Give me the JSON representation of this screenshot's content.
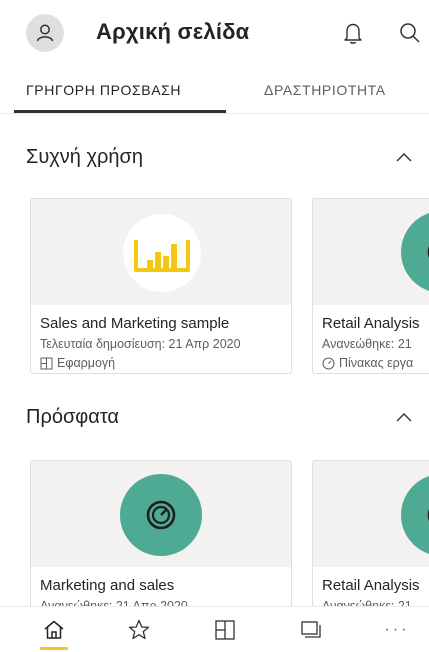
{
  "header": {
    "title": "Αρχική σελίδα",
    "avatar_icon": "person-icon",
    "notification_icon": "bell-icon",
    "search_icon": "search-icon"
  },
  "tabs": [
    {
      "label": "ΓΡΗΓΟΡΗ ΠΡΟΣΒΑΣΗ",
      "active": true
    },
    {
      "label": "ΔΡΑΣΤΗΡΙΟΤΗΤΑ",
      "active": false
    }
  ],
  "sections": {
    "frequent": {
      "title": "Συχνή χρήση",
      "cards": [
        {
          "title": "Sales and Marketing sample",
          "subtitle": "Τελευταία δημοσίευση: 21 Απρ 2020",
          "type_label": "Εφαρμογή",
          "type_icon": "app-icon",
          "thumb_icon": "bar-chart-icon"
        },
        {
          "title": "Retail Analysis",
          "subtitle": "Ανανεώθηκε: 21",
          "type_label": "Πίνακας εργα",
          "type_icon": "dashboard-icon",
          "thumb_icon": "dashboard-icon"
        }
      ]
    },
    "recent": {
      "title": "Πρόσφατα",
      "cards": [
        {
          "title": "Marketing and sales",
          "subtitle": "Ανανεώθηκε: 21 Απρ 2020",
          "thumb_icon": "dashboard-icon"
        },
        {
          "title": "Retail Analysis",
          "subtitle": "Ανανεώθηκε: 21",
          "thumb_icon": "dashboard-icon"
        }
      ]
    }
  },
  "bottom_nav": {
    "items": [
      {
        "icon": "home-icon",
        "active": true
      },
      {
        "icon": "star-icon",
        "active": false
      },
      {
        "icon": "apps-icon",
        "active": false
      },
      {
        "icon": "workspaces-icon",
        "active": false
      },
      {
        "icon": "more-icon",
        "label": "···",
        "active": false
      }
    ]
  },
  "colors": {
    "accent_yellow": "#f2c811",
    "teal": "#4faa94",
    "text_primary": "#252423",
    "text_secondary": "#605e5c",
    "thumb_bg": "#f3f2f1"
  }
}
